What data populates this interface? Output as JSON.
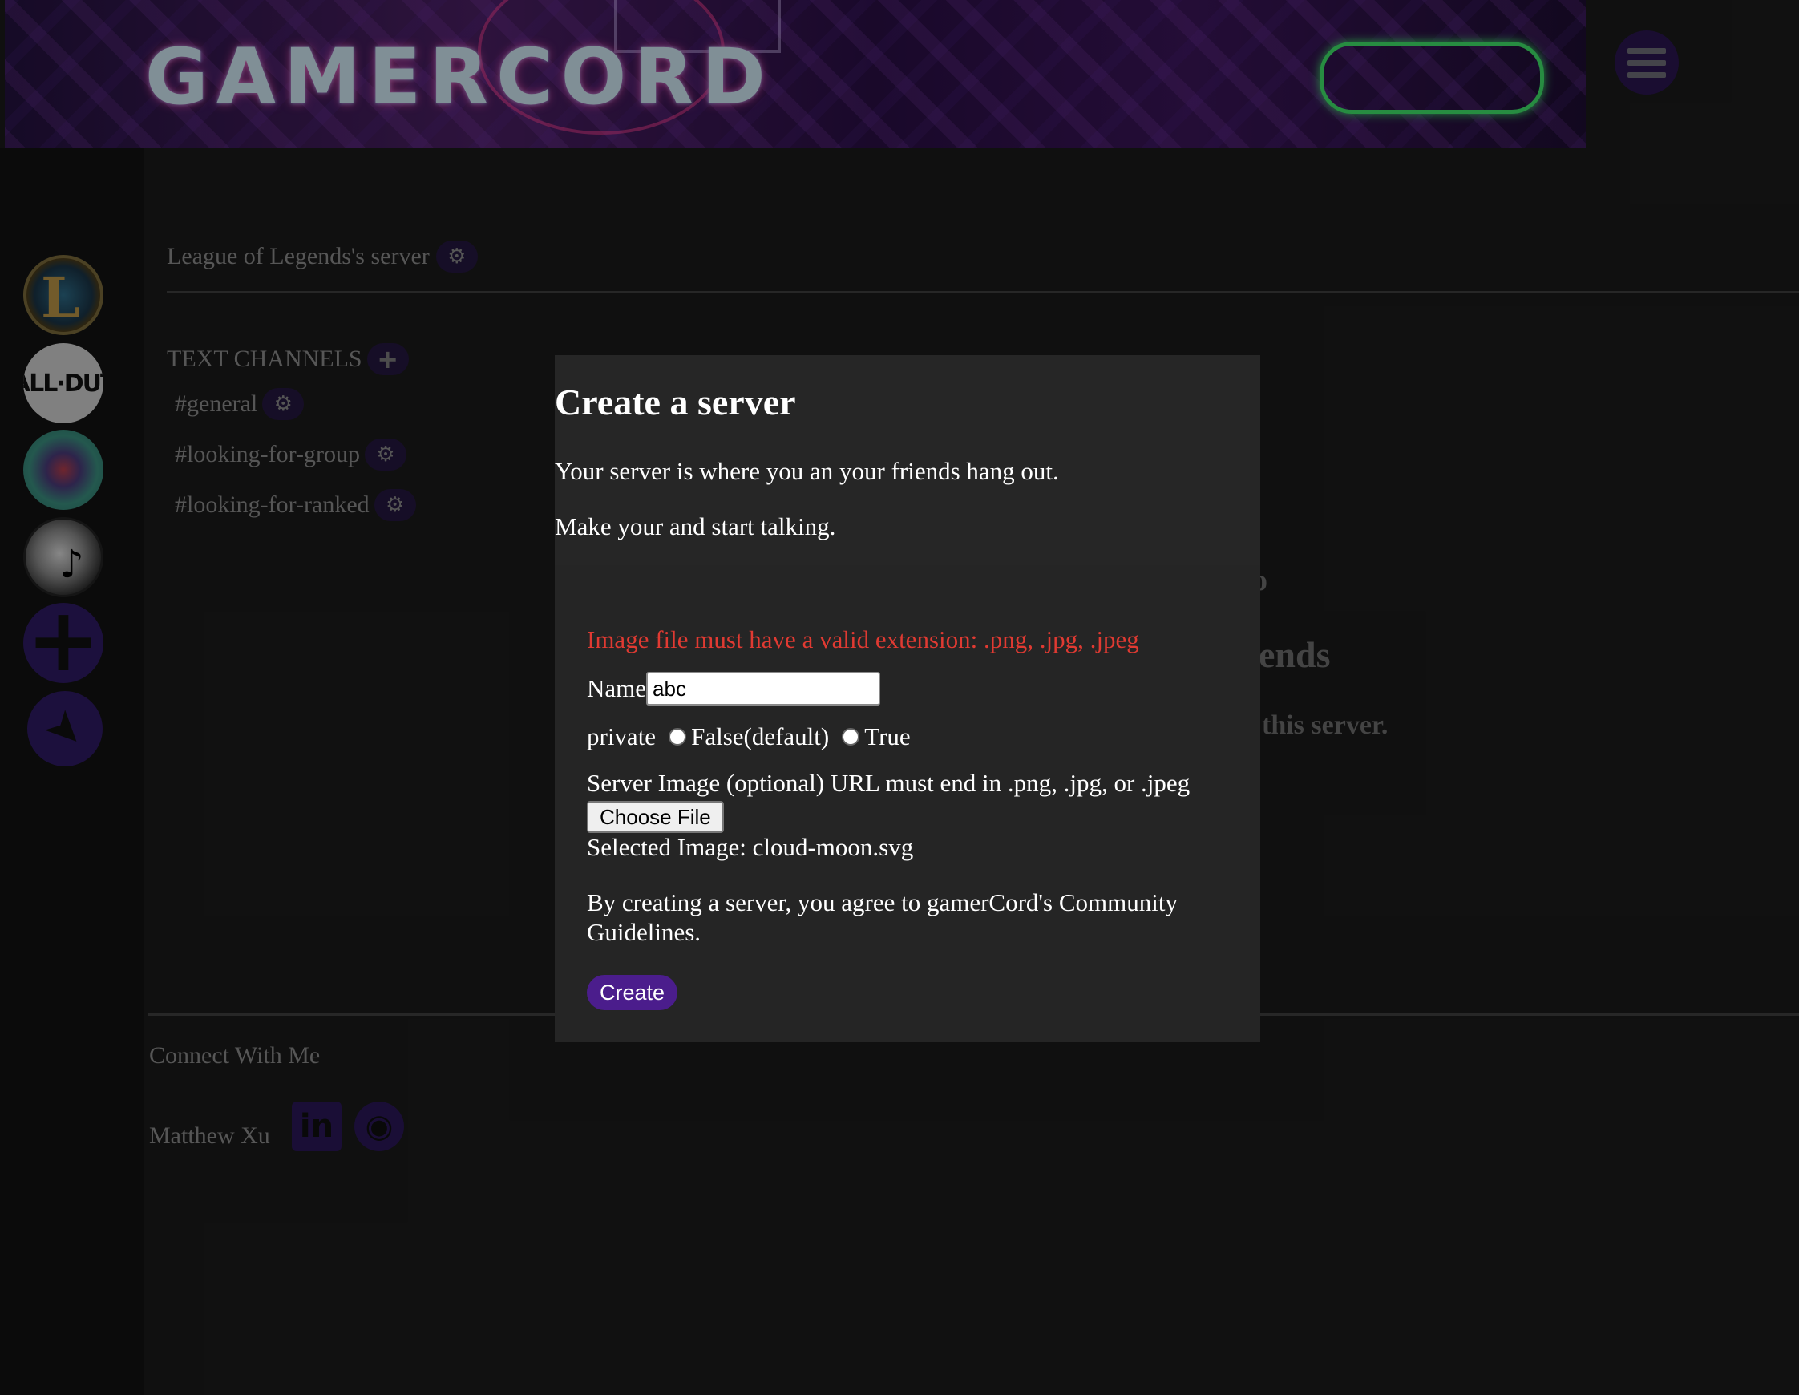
{
  "banner": {
    "brand": "GAMERCORD"
  },
  "nav": {
    "menu_icon": "hamburger-icon"
  },
  "servers": [
    {
      "name": "League of Legends",
      "glyph": "L"
    },
    {
      "name": "Call of Duty",
      "glyph": "CALL·DUTY"
    },
    {
      "name": "art server",
      "glyph": ""
    },
    {
      "name": "music server",
      "glyph": "♪"
    },
    {
      "name": "add server",
      "glyph": "+"
    },
    {
      "name": "explore",
      "glyph": "➤"
    }
  ],
  "server_panel": {
    "title": "League of Legends's server",
    "channels_header": "TEXT CHANNELS",
    "channels": [
      "#general",
      "#looking-for-group",
      "#looking-for-ranked"
    ],
    "gear_glyph": "⚙",
    "plus_glyph": "+"
  },
  "background_text": {
    "frag1": "o",
    "frag2": "ends",
    "frag3": "this server."
  },
  "footer": {
    "heading": "Connect With Me",
    "author": "Matthew Xu",
    "linkedin_glyph": "in",
    "github_glyph": "◉"
  },
  "modal": {
    "title": "Create a server",
    "line1": "Your server is where you an your friends hang out.",
    "line2": "Make your and start talking.",
    "error": "Image file must have a valid extension: .png, .jpg, .jpeg",
    "name_label": "Name",
    "name_value": "abc",
    "private_label": "private",
    "option_false": "False(default)",
    "option_true": "True",
    "image_label": "Server Image (optional) URL must end in .png, .jpg, or .jpeg",
    "choose_file": "Choose File",
    "selected_image": "Selected Image: cloud-moon.svg",
    "agreement": "By creating a server, you agree to gamerCord's Community Guidelines.",
    "create_button": "Create"
  }
}
